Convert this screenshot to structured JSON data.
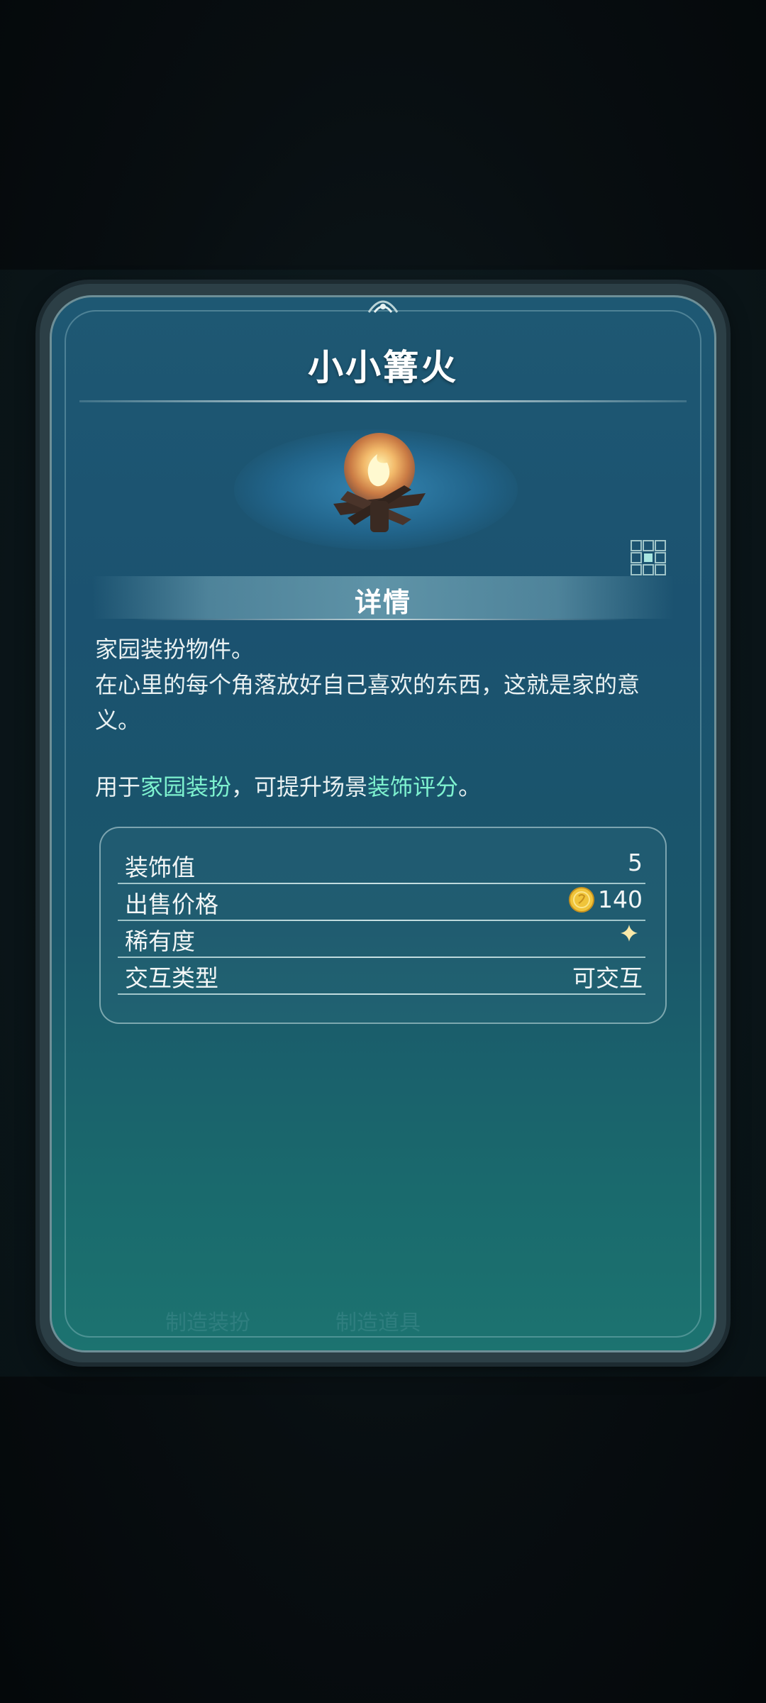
{
  "item": {
    "name": "小小篝火",
    "icon": "campfire-icon"
  },
  "details": {
    "section_title": "详情",
    "line1": "家园装扮物件。",
    "line2": "在心里的每个角落放好自己喜欢的东西，这就是家的意义。",
    "usage_prefix": "用于",
    "usage_highlight1": "家园装扮",
    "usage_middle": "，可提升场景",
    "usage_highlight2": "装饰评分",
    "usage_suffix": "。"
  },
  "stats": [
    {
      "label": "装饰值",
      "value": "5"
    },
    {
      "label": "出售价格",
      "value": "140",
      "icon": "coin-icon"
    },
    {
      "label": "稀有度",
      "value": "",
      "icon": "rarity-star-icon"
    },
    {
      "label": "交互类型",
      "value": "可交互"
    }
  ],
  "background_ui": {
    "bottom_tabs": [
      "制造装扮",
      "制造道具"
    ]
  },
  "colors": {
    "card_top": "#1e5873",
    "card_bottom": "#1c7370",
    "highlight": "#7ef2cf",
    "coin": "#f0c43a"
  }
}
